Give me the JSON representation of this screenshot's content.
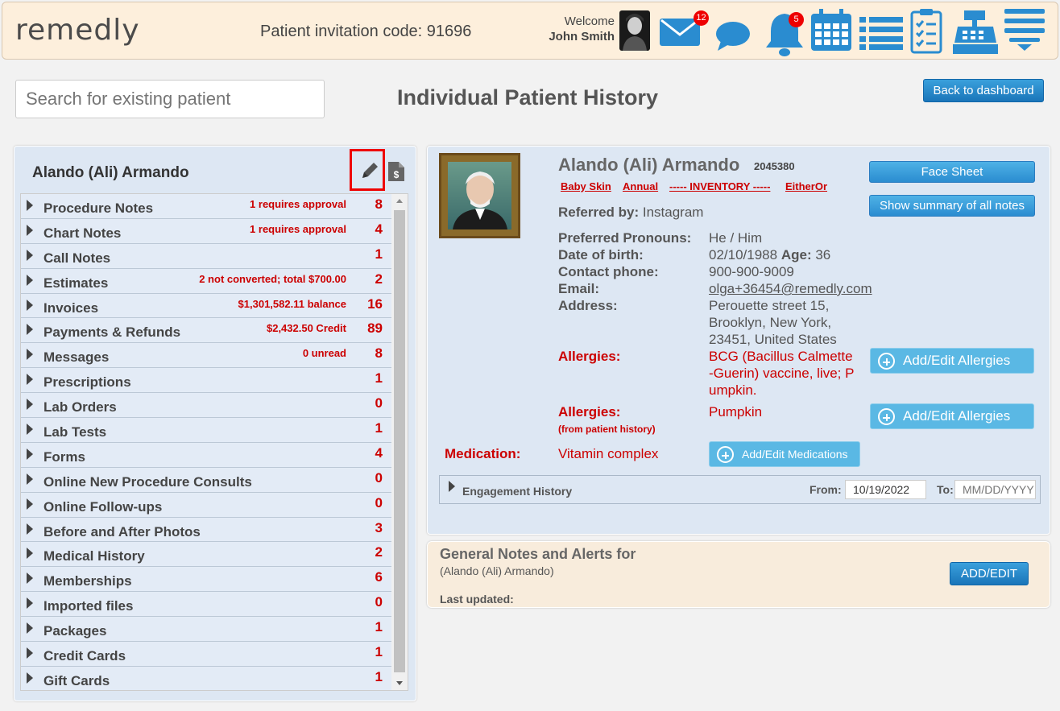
{
  "header": {
    "logo": "remedly",
    "invite_label": "Patient invitation code: 91696",
    "welcome": "Welcome",
    "user_name": "John Smith",
    "mail_badge": "12",
    "bell_badge": "5"
  },
  "search": {
    "placeholder": "Search for existing patient"
  },
  "page_title": "Individual Patient History",
  "back_button": "Back to dashboard",
  "left_panel": {
    "patient_name": "Alando (Ali) Armando",
    "items": [
      {
        "label": "Procedure Notes",
        "note": "1 requires approval",
        "count": "8"
      },
      {
        "label": "Chart Notes",
        "note": "1 requires approval",
        "count": "4"
      },
      {
        "label": "Call Notes",
        "note": "",
        "count": "1"
      },
      {
        "label": "Estimates",
        "note": "2 not converted; total $700.00",
        "count": "2"
      },
      {
        "label": "Invoices",
        "note": "$1,301,582.11 balance",
        "count": "16"
      },
      {
        "label": "Payments & Refunds",
        "note": "$2,432.50 Credit",
        "count": "89"
      },
      {
        "label": "Messages",
        "note": "0 unread",
        "count": "8"
      },
      {
        "label": "Prescriptions",
        "note": "",
        "count": "1"
      },
      {
        "label": "Lab Orders",
        "note": "",
        "count": "0"
      },
      {
        "label": "Lab Tests",
        "note": "",
        "count": "1"
      },
      {
        "label": "Forms",
        "note": "",
        "count": "4"
      },
      {
        "label": "Online New Procedure Consults",
        "note": "",
        "count": "0"
      },
      {
        "label": "Online Follow-ups",
        "note": "",
        "count": "0"
      },
      {
        "label": "Before and After Photos",
        "note": "",
        "count": "3"
      },
      {
        "label": "Medical History",
        "note": "",
        "count": "2"
      },
      {
        "label": "Memberships",
        "note": "",
        "count": "6"
      },
      {
        "label": "Imported files",
        "note": "",
        "count": "0"
      },
      {
        "label": "Packages",
        "note": "",
        "count": "1"
      },
      {
        "label": "Credit Cards",
        "note": "",
        "count": "1"
      },
      {
        "label": "Gift Cards",
        "note": "",
        "count": "1"
      }
    ]
  },
  "patient": {
    "name": "Alando (Ali) Armando",
    "id": "2045380",
    "tags": [
      "Baby Skin",
      "Annual",
      "----- INVENTORY -----",
      "EitherOr"
    ],
    "face_sheet": "Face Sheet",
    "show_summary": "Show summary of all notes",
    "referred_label": "Referred by:",
    "referred_value": "Instagram",
    "pronouns_label": "Preferred Pronouns:",
    "pronouns_value": "He / Him",
    "dob_label": "Date of birth:",
    "dob_value": "02/10/1988",
    "age_label": "Age:",
    "age_value": "36",
    "phone_label": "Contact phone:",
    "phone_value": "900-900-9009",
    "email_label": "Email:",
    "email_value": "olga+36454@remedly.com",
    "address_label": "Address:",
    "address_lines": [
      "Perouette street 15,",
      "Brooklyn, New York,",
      "23451, United States"
    ],
    "allergies_label": "Allergies:",
    "allergies_lines": [
      "BCG (Bacillus Calmette",
      "-Guerin) vaccine, live; P",
      "umpkin."
    ],
    "allergies_button": "Add/Edit Allergies",
    "allergies2_label": "Allergies:",
    "allergies2_sub": "(from patient history)",
    "allergies2_value": "Pumpkin",
    "allergies2_button": "Add/Edit Allergies",
    "medication_label": "Medication:",
    "medication_value": "Vitamin complex",
    "medication_button": "Add/Edit Medications",
    "engagement": {
      "label": "Engagement History",
      "from_label": "From:",
      "from_value": "10/19/2022",
      "to_label": "To:",
      "to_placeholder": "MM/DD/YYYY"
    }
  },
  "notes": {
    "title": "General Notes and Alerts for",
    "subtitle": "(Alando (Ali) Armando)",
    "updated_label": "Last updated:",
    "button": "ADD/EDIT"
  },
  "colors": {
    "accent": "#2a8cd0",
    "header_bg": "#fdefdc",
    "alert_red": "#c00000",
    "panel_bg": "#dde7f3"
  }
}
